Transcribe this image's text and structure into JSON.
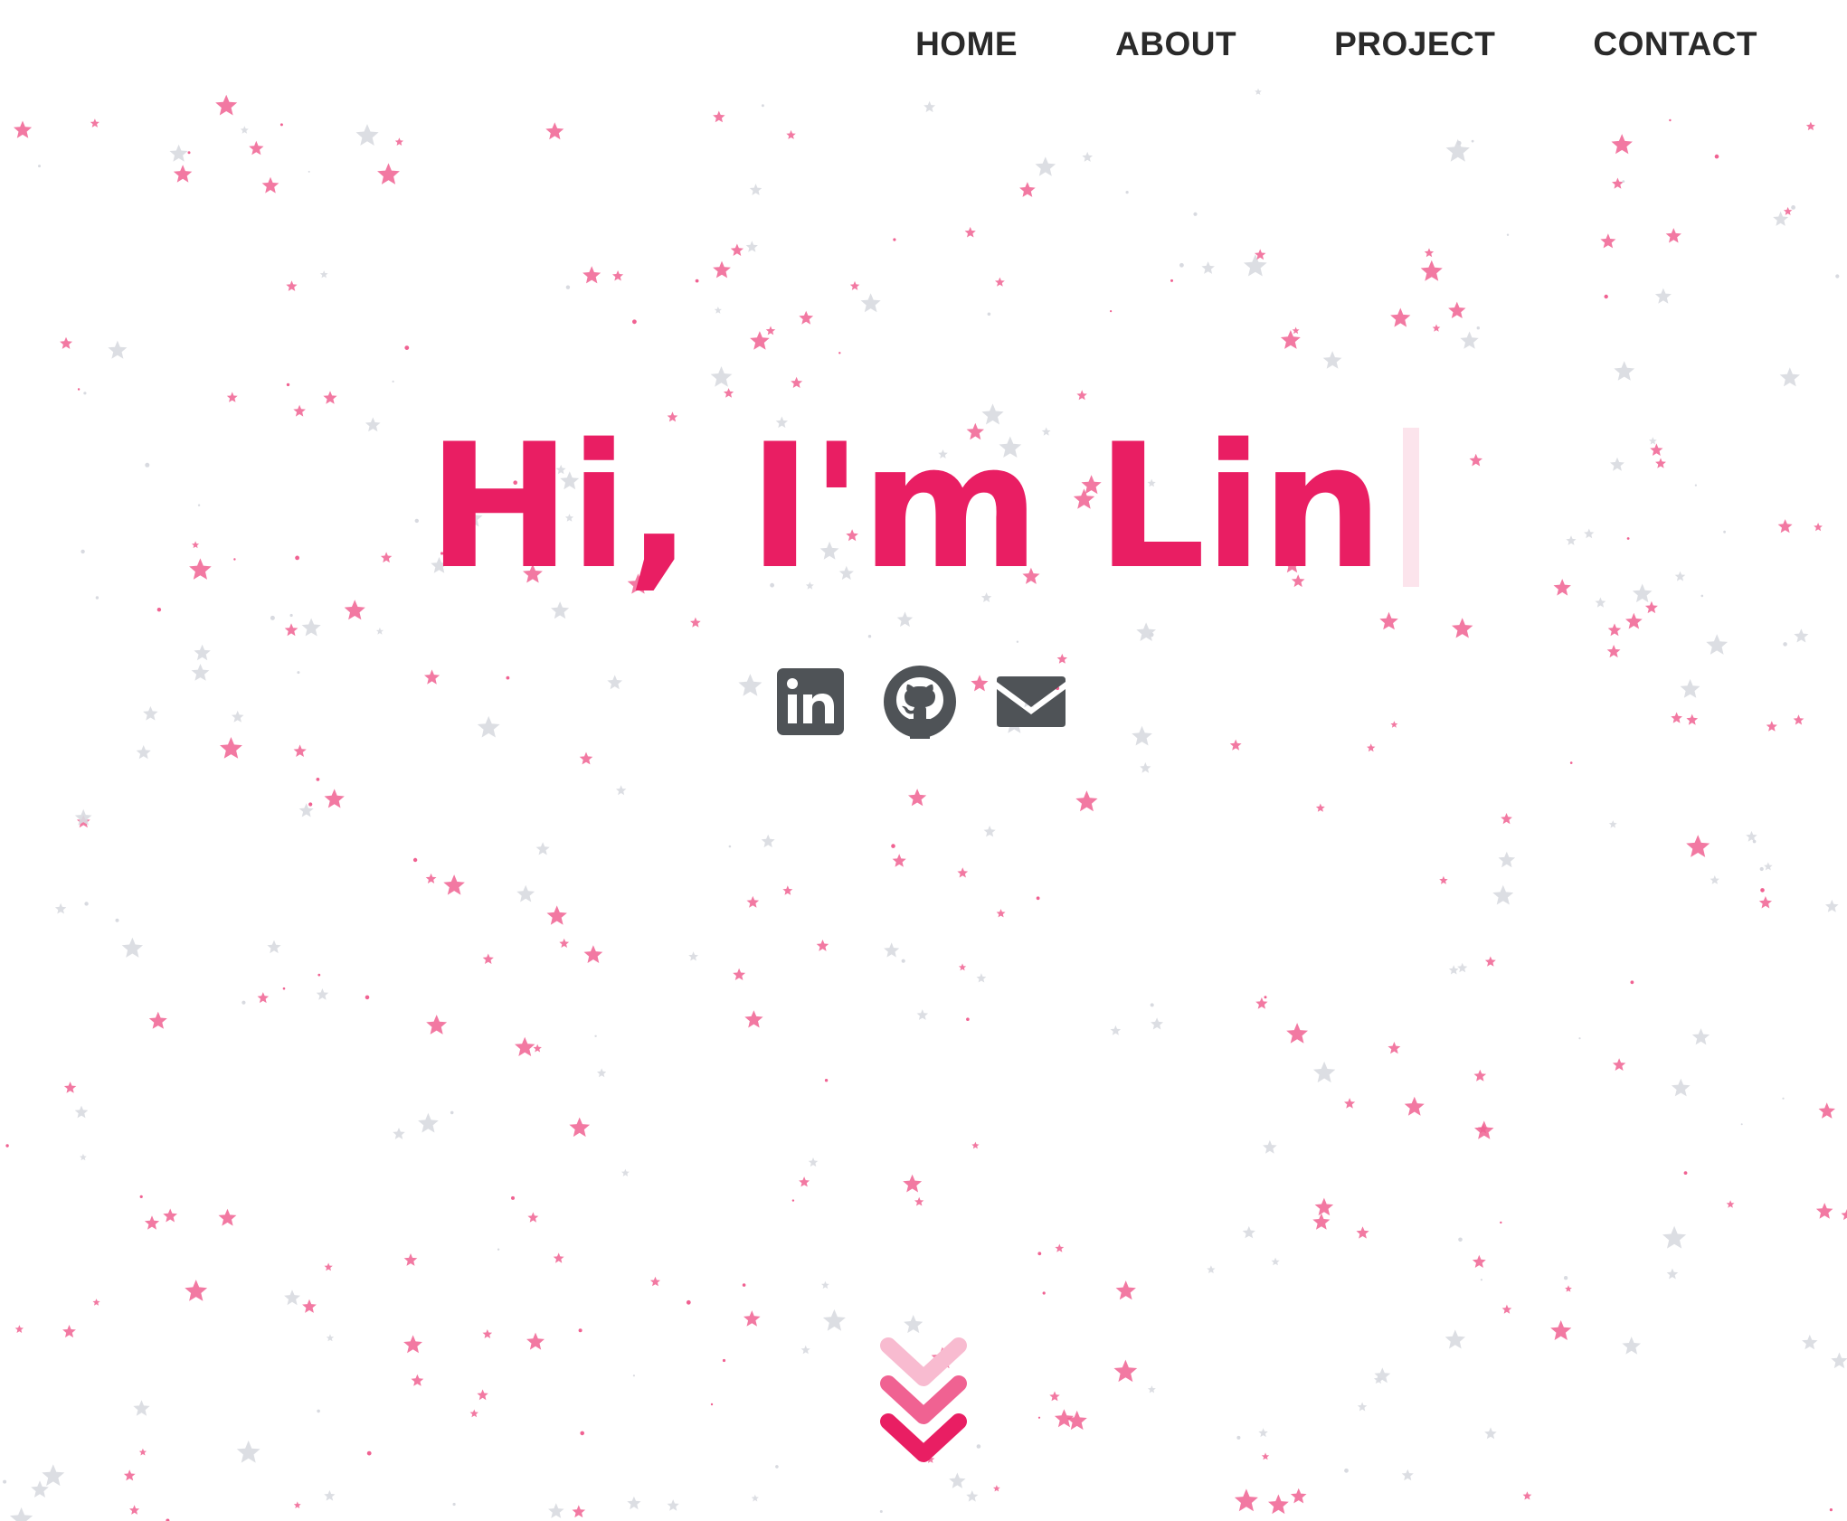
{
  "nav": {
    "items": [
      {
        "label": "HOME"
      },
      {
        "label": "ABOUT"
      },
      {
        "label": "PROJECT"
      },
      {
        "label": "CONTACT"
      }
    ]
  },
  "hero": {
    "title": "Hi, I'm Lin"
  },
  "social": {
    "icons": [
      "linkedin-icon",
      "github-icon",
      "mail-icon"
    ]
  },
  "colors": {
    "accent": "#e91e63",
    "star_pink": "#f06292",
    "star_gray": "#d8dae0",
    "text_dark": "#2a2a2a",
    "icon_gray": "#4f5357"
  }
}
